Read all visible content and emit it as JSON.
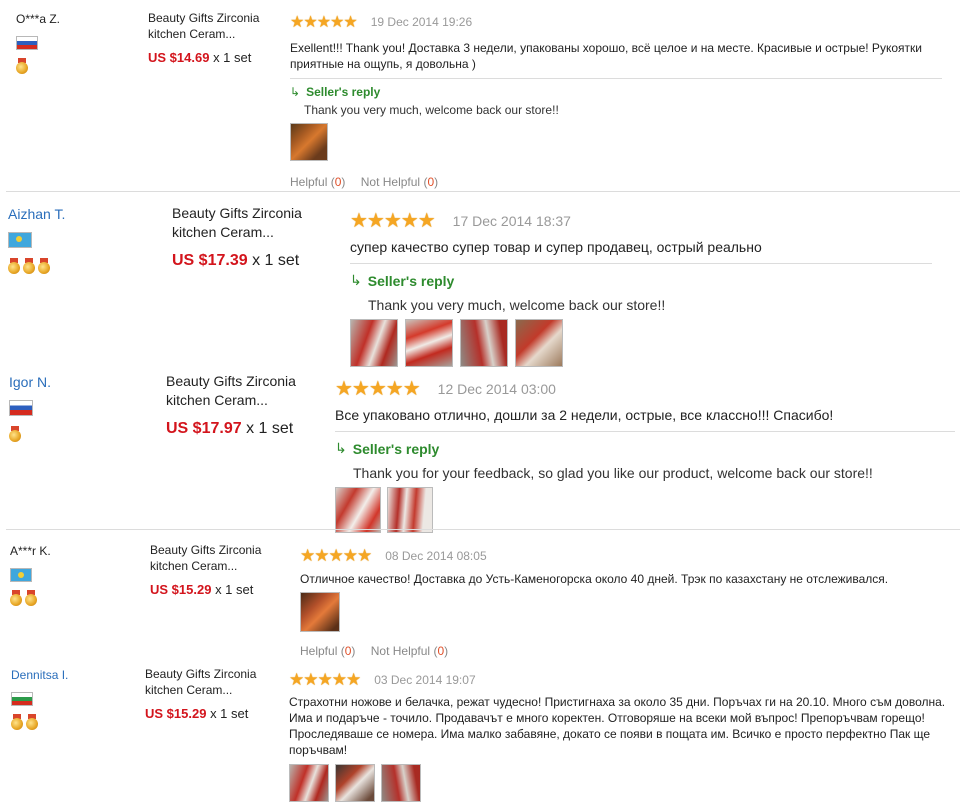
{
  "reviews": [
    {
      "buyer": "O***a Z.",
      "product": "Beauty Gifts Zirconia kitchen Ceram...",
      "price": "US $14.69",
      "qty": "x 1 set",
      "stars": "★★★★★",
      "date": "19 Dec 2014 19:26",
      "text": "Exellent!!! Thank you! Доставка 3 недели, упакованы хорошо, всё целое и на месте. Красивые и острые! Рукоятки приятные на ощупь, я довольна )",
      "reply_label": "Seller's reply",
      "reply": "Thank you very much, welcome back our store!!",
      "helpful_label": "Helpful",
      "helpful_count": "0",
      "not_helpful_label": "Not Helpful",
      "not_helpful_count": "0"
    },
    {
      "buyer": "Aizhan T.",
      "product": "Beauty Gifts Zirconia kitchen Ceram...",
      "price": "US $17.39",
      "qty": "x 1 set",
      "stars": "★★★★★",
      "date": "17 Dec 2014 18:37",
      "text": "супер качество супер товар и супер продавец, острый реально",
      "reply_label": "Seller's reply",
      "reply": "Thank you very much, welcome back our store!!"
    },
    {
      "buyer": "Igor N.",
      "product": "Beauty Gifts Zirconia kitchen Ceram...",
      "price": "US $17.97",
      "qty": "x 1 set",
      "stars": "★★★★★",
      "date": "12 Dec 2014 03:00",
      "text": "Все упаковано отлично, дошли за 2 недели, острые, все классно!!! Спасибо!",
      "reply_label": "Seller's reply",
      "reply": "Thank you for your feedback, so glad you like our product, welcome back our store!!"
    },
    {
      "buyer": "A***r K.",
      "product": "Beauty Gifts Zirconia kitchen Ceram...",
      "price": "US $15.29",
      "qty": "x 1 set",
      "stars": "★★★★★",
      "date": "08 Dec 2014 08:05",
      "text": "Отличное качество! Доставка до Усть-Каменогорска около 40 дней. Трэк по казахстану не отслеживался.",
      "helpful_label": "Helpful",
      "helpful_count": "0",
      "not_helpful_label": "Not Helpful",
      "not_helpful_count": "0"
    },
    {
      "buyer": "Dennitsa I.",
      "product": "Beauty Gifts Zirconia kitchen Ceram...",
      "price": "US $15.29",
      "qty": "x 1 set",
      "stars": "★★★★★",
      "date": "03 Dec 2014 19:07",
      "text": "Страхотни ножове и белачка, режат чудесно! Пристигнаха за около 35 дни. Поръчах ги на 20.10. Много съм доволна. Има и подаръче - точило. Продавачът е много коректен. Отговоряше на всеки мой въпрос! Препоръчвам горещо! Проследяваше се номера. Има малко забавяне, докато се появи в пощата им. Всичко е просто перфектно Пак ще поръчвам!"
    }
  ]
}
